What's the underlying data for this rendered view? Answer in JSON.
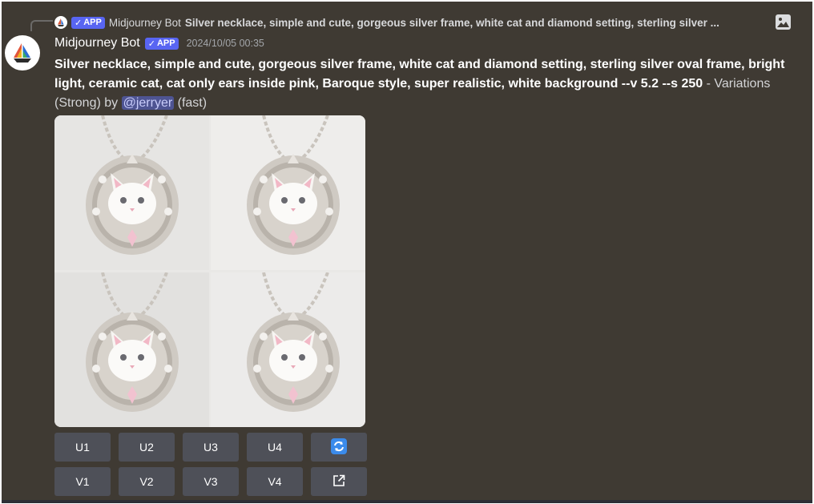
{
  "reply": {
    "badge": "APP",
    "author": "Midjourney Bot",
    "text": "Silver necklace, simple and cute, gorgeous silver frame, white cat and diamond setting, sterling silver ..."
  },
  "message": {
    "author": "Midjourney Bot",
    "badge": "APP",
    "timestamp": "2024/10/05 00:35",
    "prompt": "Silver necklace, simple and cute, gorgeous silver frame, white cat and diamond setting, sterling silver oval frame, bright light, ceramic cat, cat only ears inside pink, Baroque style, super realistic, white background --v 5.2 --s 250",
    "separator": " - ",
    "variation_label": "Variations (Strong) by ",
    "mention": "@jerryer",
    "speed": " (fast)"
  },
  "buttons": {
    "upscale": [
      "U1",
      "U2",
      "U3",
      "U4"
    ],
    "variation": [
      "V1",
      "V2",
      "V3",
      "V4"
    ],
    "reroll_icon": "refresh-icon",
    "open_icon": "external-link-icon"
  },
  "colors": {
    "background": "#3f3a33",
    "button": "#4e5058",
    "badge": "#5865f2",
    "mention_bg": "#4e5492",
    "reroll": "#5865f2"
  }
}
